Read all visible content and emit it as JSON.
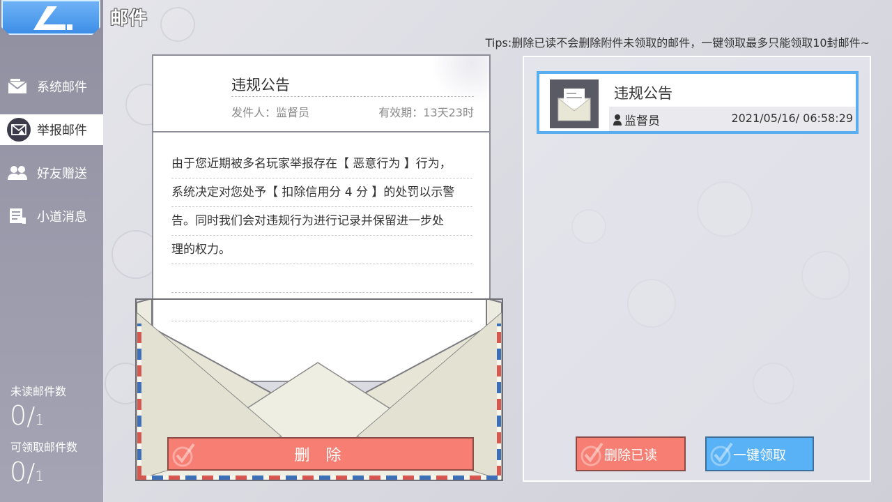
{
  "header": {
    "title": "邮件",
    "tips": "Tips:删除已读不会删除附件未领取的邮件，一键领取最多只能领取10封邮件~"
  },
  "sidebar": {
    "items": [
      {
        "label": "系统邮件",
        "icon": "mail-icon",
        "active": false
      },
      {
        "label": "举报邮件",
        "icon": "warning-mail-icon",
        "active": true
      },
      {
        "label": "好友赠送",
        "icon": "friends-icon",
        "active": false
      },
      {
        "label": "小道消息",
        "icon": "news-icon",
        "active": false
      }
    ],
    "unread_label": "未读邮件数",
    "unread_count": "0",
    "unread_total": "1",
    "claimable_label": "可领取邮件数",
    "claimable_count": "0",
    "claimable_total": "1"
  },
  "letter": {
    "subject": "违规公告",
    "sender": "发件人：监督员",
    "validity": "有效期：13天23时",
    "lines": [
      "由于您近期被多名玩家举报存在【 恶意行为 】行为，",
      "系统决定对您处予【 扣除信用分 4 分 】的处罚以示警",
      "告。同时我们会对违规行为进行记录并保留进一步处",
      "理的权力。",
      "",
      ""
    ],
    "delete_label": "删 除"
  },
  "mail_list": {
    "items": [
      {
        "title": "违规公告",
        "sender": "监督员",
        "date": "2021/05/16/ 06:58:29",
        "selected": true
      }
    ],
    "delete_read_label": "删除已读",
    "claim_all_label": "一键领取"
  },
  "colors": {
    "accent_blue": "#58b2f5",
    "delete_red": "#f67e73",
    "sidebar": "#9a9aab"
  }
}
